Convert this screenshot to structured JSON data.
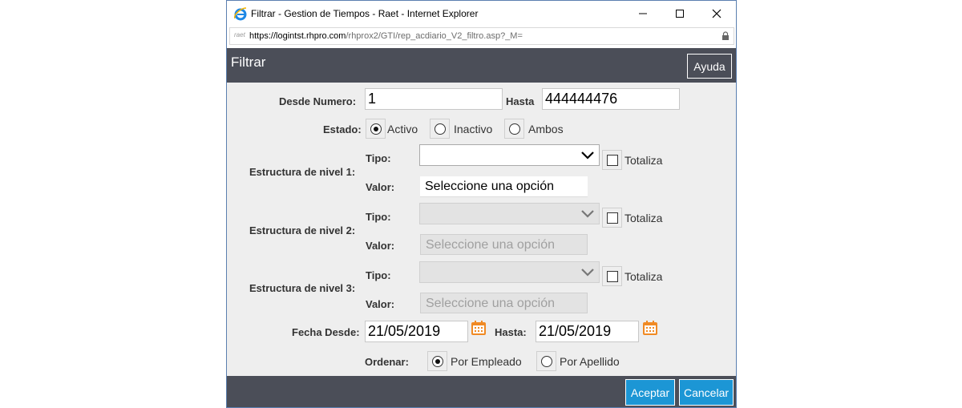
{
  "window": {
    "title": "Filtrar - Gestion de Tiempos - Raet - Internet Explorer",
    "address_badge": "raet",
    "url_prefix": "https://",
    "url_host": "logintst.rhpro.com",
    "url_path": "/rhprox2/GTI/rep_acdiario_V2_filtro.asp?_M="
  },
  "header": {
    "title": "Filtrar",
    "help_label": "Ayuda"
  },
  "form": {
    "desde_numero_label": "Desde Numero:",
    "desde_numero_value": "1",
    "hasta_label": "Hasta",
    "hasta_value": "444444476",
    "estado_label": "Estado:",
    "estado_options": [
      "Activo",
      "Inactivo",
      "Ambos"
    ],
    "estado_selected": "Activo",
    "tipo_label": "Tipo:",
    "valor_label": "Valor:",
    "totaliza_label": "Totaliza",
    "placeholder_option": "Seleccione una opción",
    "niveles": [
      {
        "label": "Estructura de nivel 1:",
        "enabled": true
      },
      {
        "label": "Estructura de nivel 2:",
        "enabled": false
      },
      {
        "label": "Estructura de nivel 3:",
        "enabled": false
      }
    ],
    "fecha_desde_label": "Fecha Desde:",
    "fecha_desde_value": "21/05/2019",
    "fecha_hasta_label": "Hasta:",
    "fecha_hasta_value": "21/05/2019",
    "ordenar_label": "Ordenar:",
    "ordenar_options": [
      "Por Empleado",
      "Por Apellido"
    ],
    "ordenar_selected": "Por Empleado"
  },
  "footer": {
    "accept_label": "Aceptar",
    "cancel_label": "Cancelar"
  },
  "colors": {
    "header_bg": "#4b4e58",
    "button_bg": "#1c96d5",
    "content_bg": "#eeeeee",
    "calendar_icon": "#f08a24"
  },
  "icons": [
    "ie-logo-icon",
    "minimize-icon",
    "maximize-icon",
    "close-icon",
    "lock-icon",
    "chevron-down-icon",
    "calendar-icon"
  ]
}
